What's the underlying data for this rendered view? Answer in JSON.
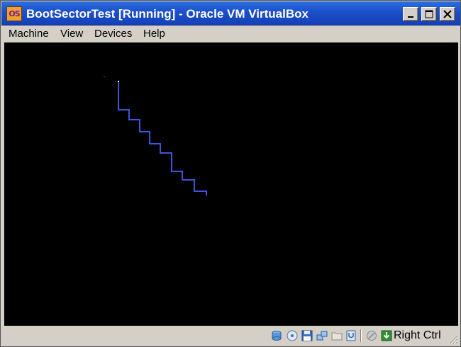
{
  "window": {
    "title": "BootSectorTest [Running] - Oracle VM VirtualBox"
  },
  "menu": {
    "items": [
      "Machine",
      "View",
      "Devices",
      "Help"
    ]
  },
  "screen": {
    "background": "#000000",
    "drawing_color": "#3c55dc",
    "drawing": "blue staircase line"
  },
  "statusbar": {
    "icons": [
      "hard-disk-icon",
      "optical-drive-icon",
      "floppy-icon",
      "network-icon",
      "shared-folders-icon",
      "usb-icon",
      "mouse-integration-icon",
      "keyboard-capture-icon"
    ],
    "host_key": "Right Ctrl"
  },
  "colors": {
    "titlebar": "#1b4fc9",
    "chrome": "#d4d0c8"
  }
}
